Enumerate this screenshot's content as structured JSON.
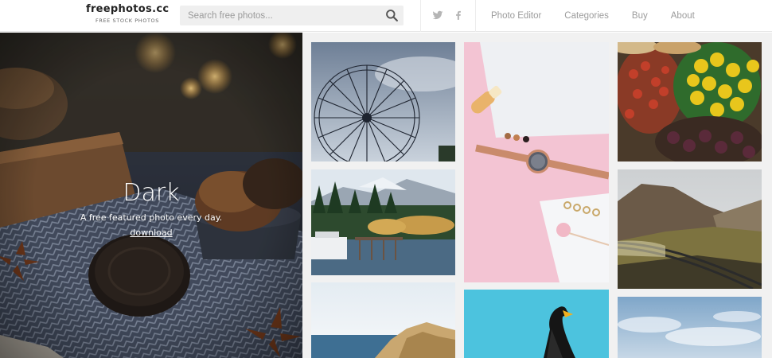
{
  "header": {
    "logo_title": "freephotos.cc",
    "logo_subtitle": "FREE STOCK PHOTOS",
    "search_placeholder": "Search free photos...",
    "search_icon": "search-icon",
    "social": [
      {
        "icon": "twitter-icon"
      },
      {
        "icon": "facebook-icon"
      }
    ],
    "nav": [
      {
        "label": "Photo Editor"
      },
      {
        "label": "Categories"
      },
      {
        "label": "Buy"
      },
      {
        "label": "About"
      }
    ]
  },
  "hero": {
    "title": "Dark",
    "subtitle": "A free featured photo every day.",
    "link_label": "download"
  },
  "grid": {
    "photos": [
      {
        "subject": "ferris wheel"
      },
      {
        "subject": "lake town with mountains"
      },
      {
        "subject": "sea and rocks"
      },
      {
        "subject": "watch on pink"
      },
      {
        "subject": "eagle on blue"
      },
      {
        "subject": "fruit market"
      },
      {
        "subject": "railway in hills"
      },
      {
        "subject": "sky"
      }
    ]
  },
  "colors": {
    "accent_text": "#222222",
    "nav_text": "#9b9b9b",
    "search_bg": "#efefef"
  }
}
